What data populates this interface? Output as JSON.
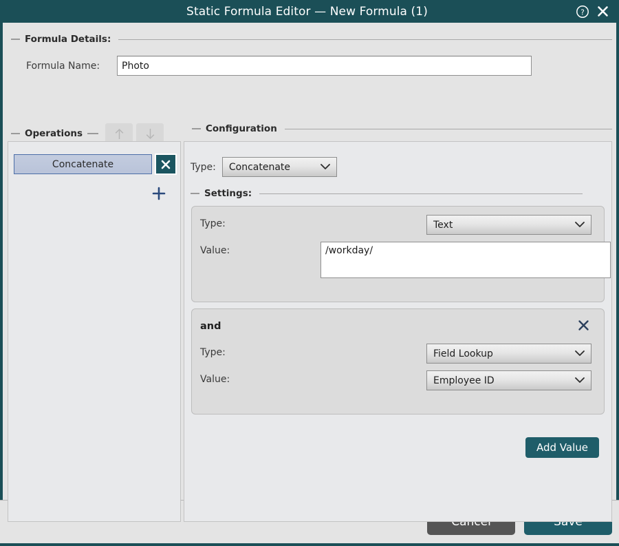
{
  "titlebar": {
    "title": "Static Formula Editor — New Formula (1)",
    "help_icon": "help-circle-icon",
    "close_icon": "close-icon"
  },
  "formula_details": {
    "group_label": "Formula Details:",
    "name_label": "Formula Name:",
    "name_value": "Photo",
    "name_placeholder": ""
  },
  "operations": {
    "group_label": "Operations",
    "move_up_icon": "arrow-up-icon",
    "move_down_icon": "arrow-down-icon",
    "add_icon": "plus-icon",
    "delete_icon": "close-icon",
    "items": [
      {
        "label": "Concatenate",
        "selected": true
      }
    ]
  },
  "configuration": {
    "group_label": "Configuration",
    "type_label": "Type:",
    "type_value": "Concatenate",
    "settings_label": "Settings:",
    "add_value_label": "Add Value",
    "cards": [
      {
        "header": "",
        "type_label": "Type:",
        "type_value": "Text",
        "value_label": "Value:",
        "value_text": "/workday/",
        "value_kind": "textarea"
      },
      {
        "header": "and",
        "remove_icon": "close-icon",
        "type_label": "Type:",
        "type_value": "Field Lookup",
        "value_label": "Value:",
        "value_text": "Employee ID",
        "value_kind": "select"
      }
    ]
  },
  "footer": {
    "cancel_label": "Cancel",
    "save_label": "Save"
  },
  "colors": {
    "titlebar": "#1b4f57",
    "accent_teal": "#1f5d69",
    "cancel_gray": "#555555",
    "selection_blue": "#b9c3d9",
    "plus_blue": "#2a4a7c"
  }
}
